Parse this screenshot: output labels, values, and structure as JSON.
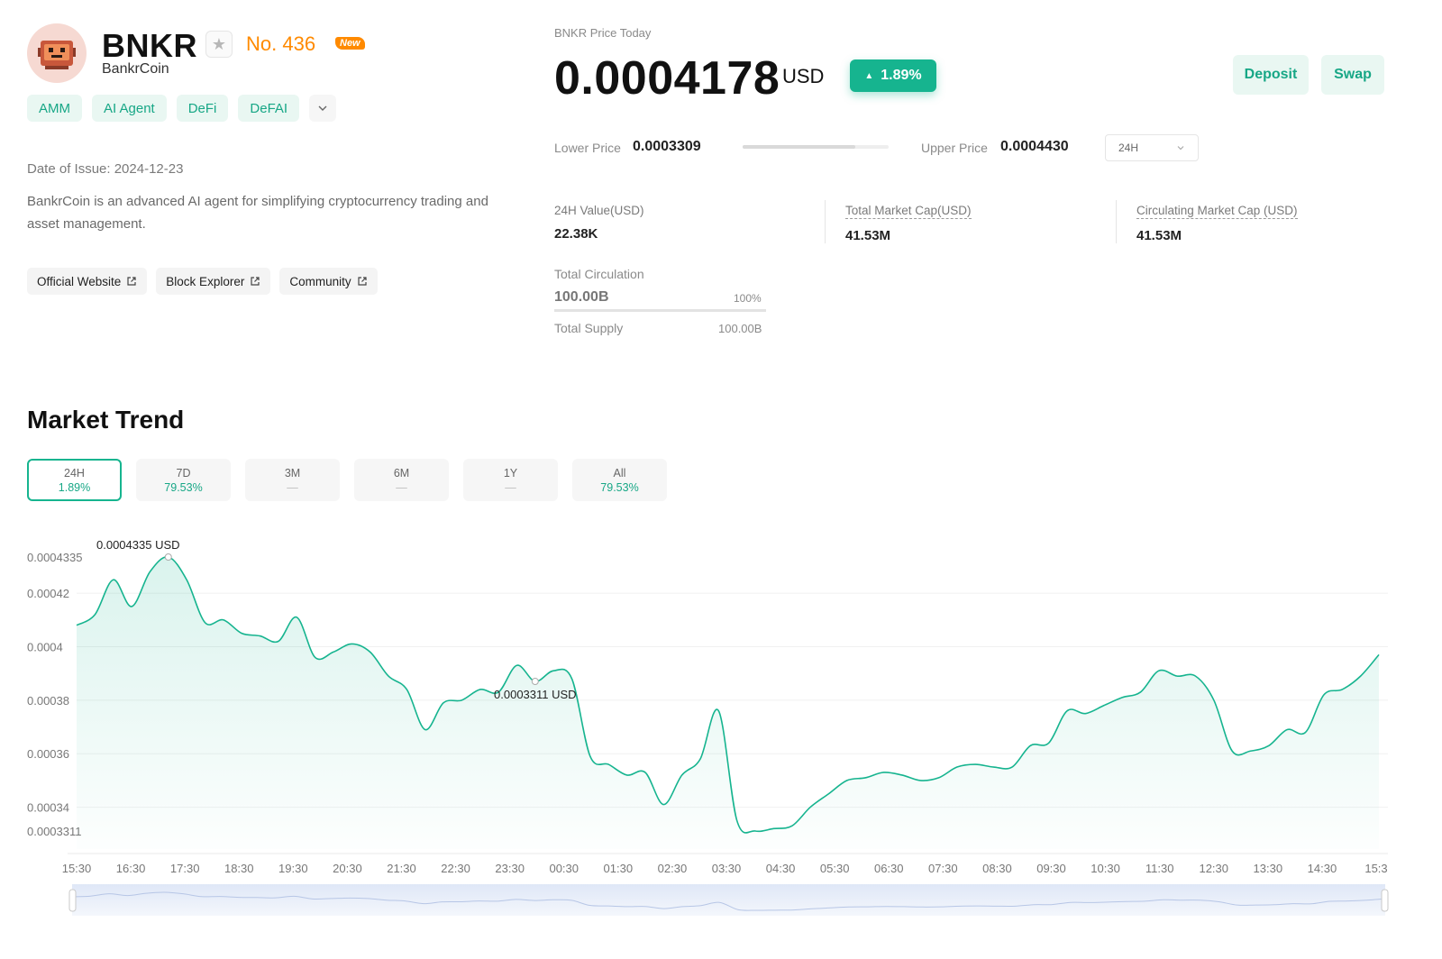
{
  "coin": {
    "ticker": "BNKR",
    "name": "BankrCoin",
    "rank": "No. 436",
    "new_badge": "New",
    "tags": [
      "AMM",
      "AI Agent",
      "DeFi",
      "DeFAI"
    ],
    "date_of_issue": "Date of Issue: 2024-12-23",
    "description": "BankrCoin is an advanced AI agent for simplifying cryptocurrency trading and asset management.",
    "links": [
      "Official Website",
      "Block Explorer",
      "Community"
    ]
  },
  "price_panel": {
    "label": "BNKR Price Today",
    "price": "0.0004178",
    "unit": "USD",
    "change": "1.89%",
    "deposit_label": "Deposit",
    "swap_label": "Swap",
    "lower_label": "Lower Price",
    "lower_value": "0.0003309",
    "upper_label": "Upper Price",
    "upper_value": "0.0004430",
    "range_position": 0.77,
    "period": "24H"
  },
  "stats": [
    {
      "label": "24H Value(USD)",
      "value": "22.38K"
    },
    {
      "label": "Total Market Cap(USD)",
      "value": "41.53M"
    },
    {
      "label": "Circulating Market Cap (USD)",
      "value": "41.53M"
    }
  ],
  "supply": {
    "circulation_label": "Total Circulation",
    "circulation_value": "100.00B",
    "circulation_pct": "100%",
    "total_supply_label": "Total Supply",
    "total_supply_value": "100.00B"
  },
  "market_trend": {
    "title": "Market Trend",
    "tabs": [
      {
        "label": "24H",
        "value": "1.89%",
        "active": true
      },
      {
        "label": "7D",
        "value": "79.53%",
        "active": false
      },
      {
        "label": "3M",
        "value": "—",
        "active": false
      },
      {
        "label": "6M",
        "value": "—",
        "active": false
      },
      {
        "label": "1Y",
        "value": "—",
        "active": false
      },
      {
        "label": "All",
        "value": "79.53%",
        "active": false
      }
    ]
  },
  "colors": {
    "accent": "#16b48f",
    "accent_light": "#e9f7f2",
    "rank_orange": "#ff8a00"
  },
  "icons": {
    "favorite": "star-icon",
    "more_tags": "chevron-down-icon",
    "external_link": "external-link-icon",
    "price_up": "triangle-up-icon"
  },
  "chart_data": {
    "type": "area",
    "x_ticks": [
      "15:30",
      "16:30",
      "17:30",
      "18:30",
      "19:30",
      "20:30",
      "21:30",
      "22:30",
      "23:30",
      "00:30",
      "01:30",
      "02:30",
      "03:30",
      "04:30",
      "05:30",
      "06:30",
      "07:30",
      "08:30",
      "09:30",
      "10:30",
      "11:30",
      "12:30",
      "13:30",
      "14:30",
      "15:3"
    ],
    "y_ticks": [
      "0.0004335",
      "0.00042",
      "0.0004",
      "0.00038",
      "0.00036",
      "0.00034",
      "0.0003311"
    ],
    "y_tick_values": [
      0.0004335,
      0.00042,
      0.0004,
      0.00038,
      0.00036,
      0.00034,
      0.0003311
    ],
    "ylim": [
      0.0003311,
      0.0004335
    ],
    "max_label": "0.0004335 USD",
    "min_label": "0.0003311 USD",
    "max_index": 5,
    "min_index": 25,
    "grid": "horizontal",
    "series": [
      {
        "values": [
          0.000408,
          0.000412,
          0.000425,
          0.000415,
          0.000428,
          0.0004335,
          0.000425,
          0.000409,
          0.00041,
          0.000405,
          0.000404,
          0.000402,
          0.000411,
          0.000396,
          0.000398,
          0.000401,
          0.000398,
          0.000389,
          0.000384,
          0.000369,
          0.000379,
          0.00038,
          0.000384,
          0.000383,
          0.000393,
          0.000387,
          0.000391,
          0.000388,
          0.000359,
          0.000356,
          0.000352,
          0.000353,
          0.000341,
          0.000352,
          0.000358,
          0.000376,
          0.000335,
          0.0003311,
          0.000332,
          0.000333,
          0.00034,
          0.000345,
          0.00035,
          0.000351,
          0.000353,
          0.000352,
          0.00035,
          0.000351,
          0.000355,
          0.000356,
          0.000355,
          0.000355,
          0.000363,
          0.000364,
          0.000376,
          0.000375,
          0.000378,
          0.000381,
          0.000383,
          0.000391,
          0.000389,
          0.000389,
          0.00038,
          0.000361,
          0.000361,
          0.000363,
          0.000369,
          0.000368,
          0.000382,
          0.000384,
          0.000389,
          0.000397
        ]
      }
    ]
  }
}
